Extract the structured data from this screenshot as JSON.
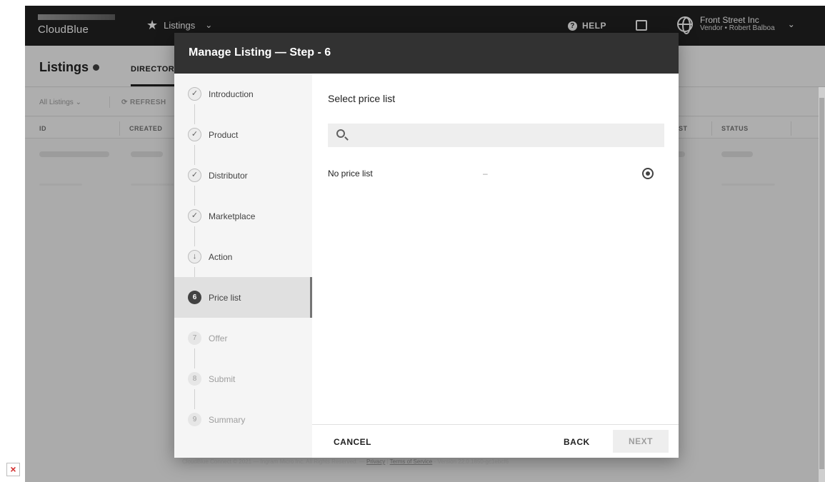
{
  "topbar": {
    "logo_text": "CloudBlue",
    "nav_label": "Listings",
    "help_label": "HELP",
    "account_name": "Front Street Inc",
    "account_sub": "Vendor • Robert Balboa"
  },
  "page": {
    "title": "Listings",
    "tab_directory": "DIRECTOR",
    "toolbar_all": "All Listings ⌄",
    "toolbar_refresh": "⟳ REFRESH",
    "columns": [
      "ID",
      "CREATED",
      "ST",
      "STATUS"
    ]
  },
  "modal": {
    "title": "Manage Listing — Step - 6",
    "steps": [
      {
        "icon": "✓",
        "label": "Introduction"
      },
      {
        "icon": "✓",
        "label": "Product"
      },
      {
        "icon": "✓",
        "label": "Distributor"
      },
      {
        "icon": "✓",
        "label": "Marketplace"
      },
      {
        "icon": "↓",
        "label": "Action"
      },
      {
        "icon": "6",
        "label": "Price list"
      },
      {
        "icon": "7",
        "label": "Offer"
      },
      {
        "icon": "8",
        "label": "Submit"
      },
      {
        "icon": "9",
        "label": "Summary"
      }
    ],
    "content_title": "Select price list",
    "search_placeholder": "",
    "price_list_name": "No price list",
    "price_list_dash": "–",
    "cancel_label": "CANCEL",
    "back_label": "BACK",
    "next_label": "NEXT"
  },
  "footer": {
    "prefix": "CloudBlue Connect © 2021 — Ingram Micro Inc. All Rights Reserved. —",
    "privacy": "Privacy",
    "sep": "|",
    "terms": "Terms of Service",
    "version": "- Version 22.0.1850-gc1ebcf6"
  },
  "colors": {
    "topbar": "#212121",
    "modal_header": "#323232",
    "active_step": "#424242"
  }
}
